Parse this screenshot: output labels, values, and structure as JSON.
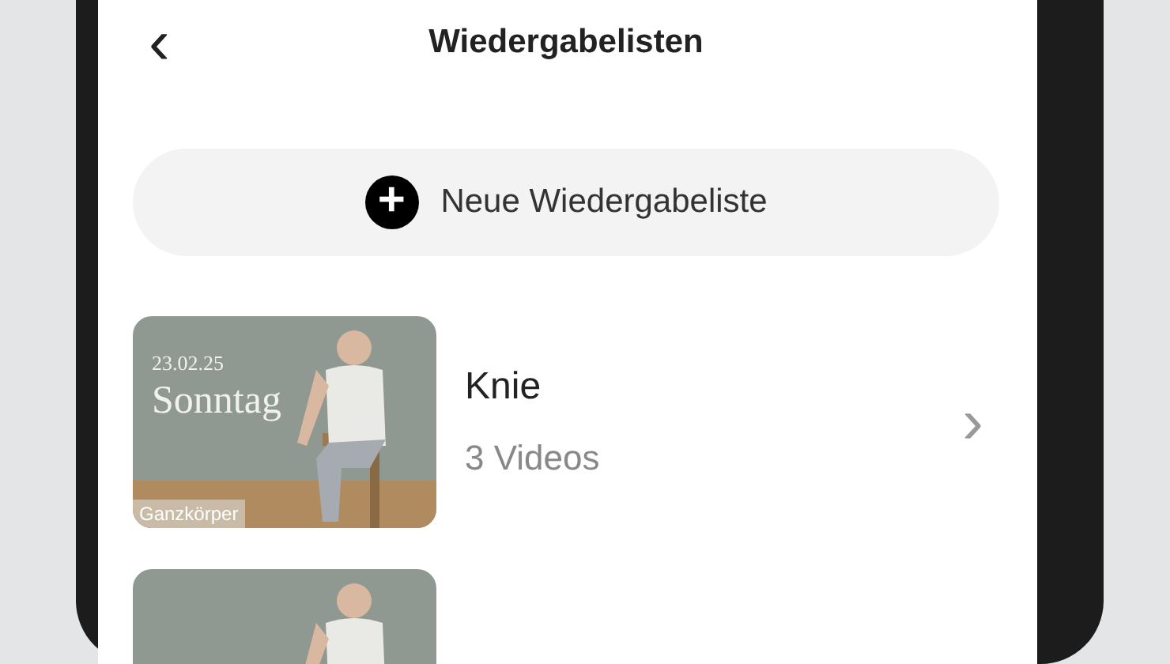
{
  "header": {
    "back": "‹",
    "title": "Wiedergabelisten"
  },
  "new_button": {
    "icon": "+",
    "label": "Neue Wiedergabeliste"
  },
  "playlists": [
    {
      "thumbnail": {
        "kind": "picture",
        "date": "23.02.25",
        "day": "Sonntag",
        "tag": "Ganzkörper"
      },
      "name": "Knie",
      "count": "3 Videos",
      "chevron": "›"
    },
    {
      "thumbnail": {
        "kind": "picture"
      }
    }
  ]
}
